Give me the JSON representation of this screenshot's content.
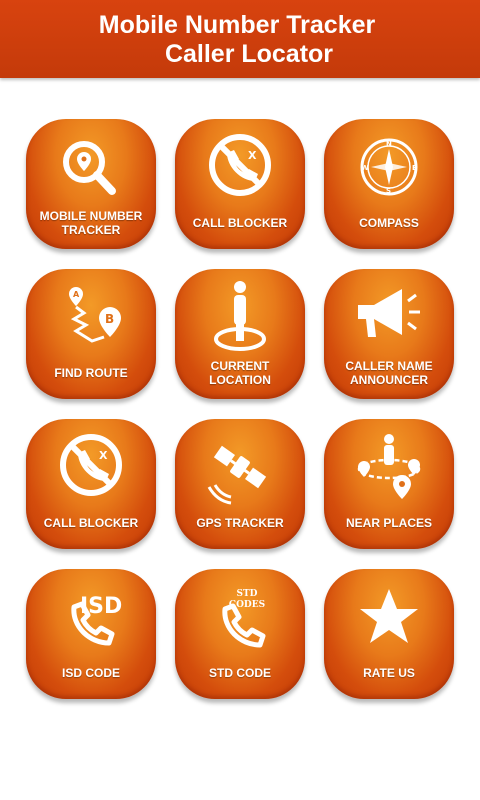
{
  "header": {
    "title_line1": "Mobile Number Tracker",
    "title_line2": "Caller Locator"
  },
  "colors": {
    "header_bg": "#c9400d",
    "tile_top": "#f39a27",
    "tile_bottom": "#c13a06",
    "text": "#ffffff"
  },
  "tiles": [
    {
      "label": "MOBILE NUMBER\nTRACKER",
      "icon": "search-location-icon"
    },
    {
      "label": "CALL BLOCKER",
      "icon": "call-blocked-icon"
    },
    {
      "label": "COMPASS",
      "icon": "compass-icon"
    },
    {
      "label": "FIND ROUTE",
      "icon": "route-icon"
    },
    {
      "label": "CURRENT\nLOCATION",
      "icon": "current-location-icon"
    },
    {
      "label": "CALLER NAME\nANNOUNCER",
      "icon": "megaphone-icon"
    },
    {
      "label": "CALL BLOCKER",
      "icon": "call-blocked-icon"
    },
    {
      "label": "GPS TRACKER",
      "icon": "satellite-icon"
    },
    {
      "label": "NEAR PLACES",
      "icon": "near-places-icon"
    },
    {
      "label": "ISD CODE",
      "icon": "isd-phone-icon",
      "icon_text": "ISD"
    },
    {
      "label": "STD CODE",
      "icon": "std-phone-icon",
      "icon_text": "STD\nCODES"
    },
    {
      "label": "RATE US",
      "icon": "star-icon"
    }
  ]
}
